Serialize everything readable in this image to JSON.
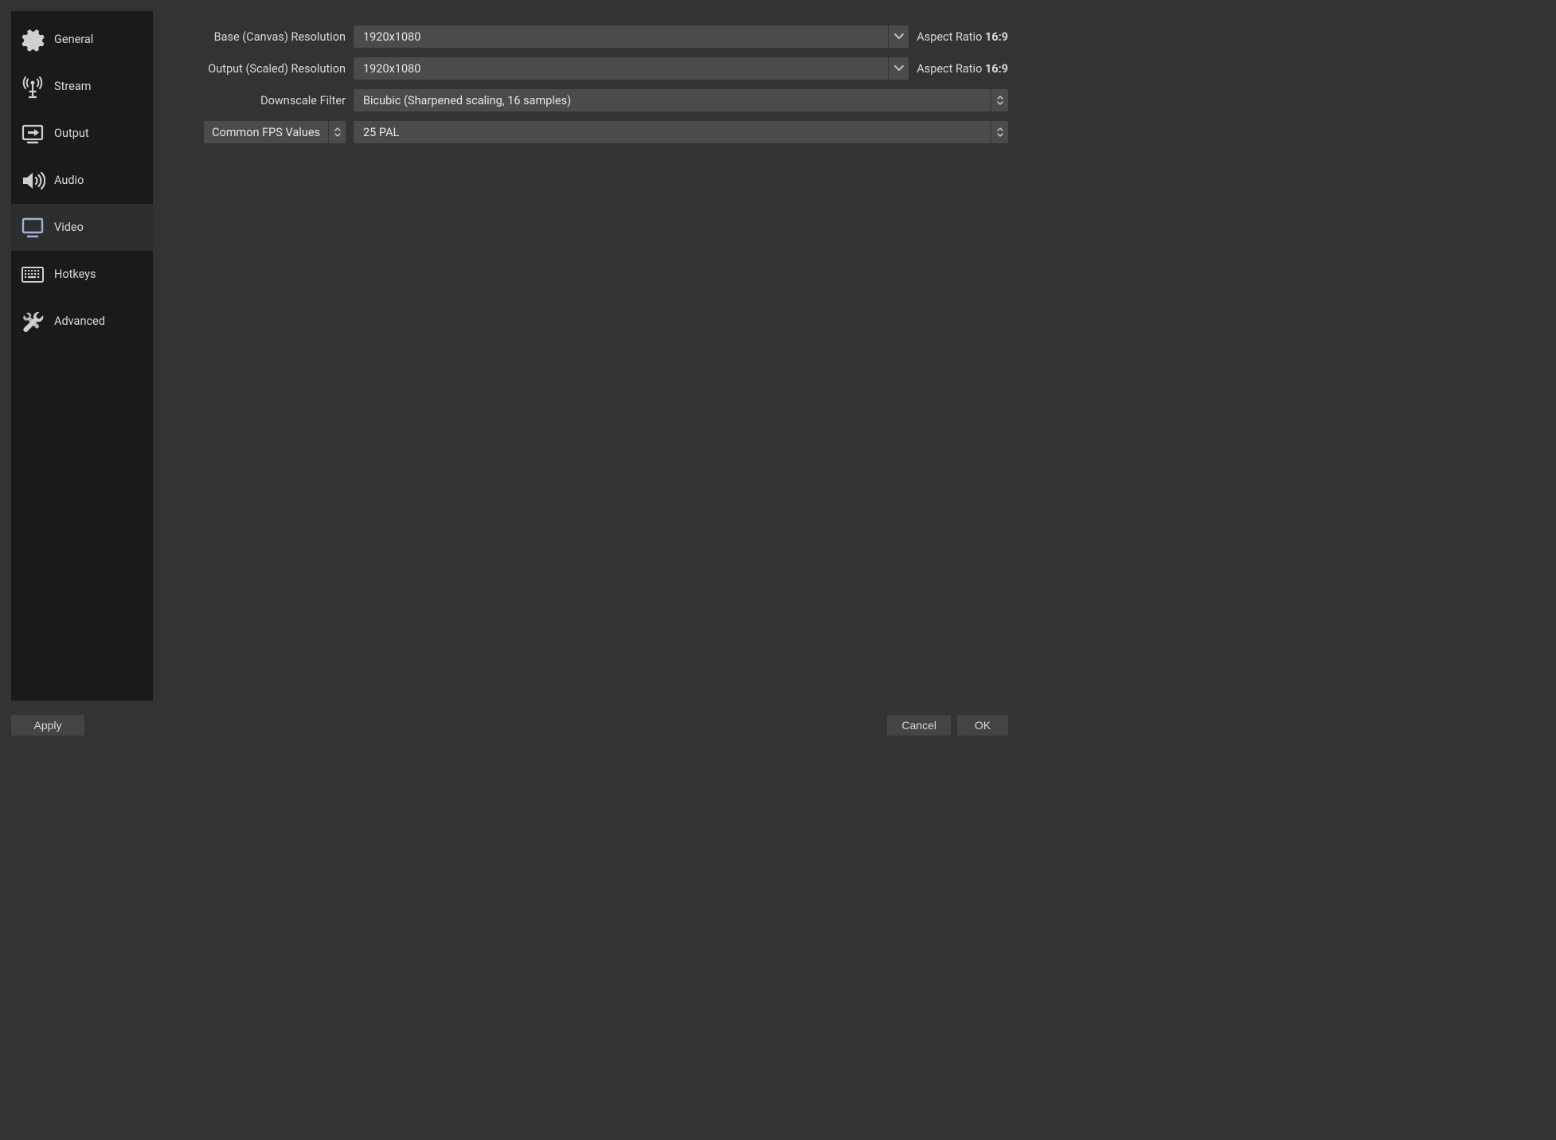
{
  "sidebar": {
    "items": [
      {
        "label": "General",
        "selected": false,
        "icon": "gear-icon"
      },
      {
        "label": "Stream",
        "selected": false,
        "icon": "antenna-icon"
      },
      {
        "label": "Output",
        "selected": false,
        "icon": "output-icon"
      },
      {
        "label": "Audio",
        "selected": false,
        "icon": "speaker-icon"
      },
      {
        "label": "Video",
        "selected": true,
        "icon": "monitor-icon"
      },
      {
        "label": "Hotkeys",
        "selected": false,
        "icon": "keyboard-icon"
      },
      {
        "label": "Advanced",
        "selected": false,
        "icon": "tools-icon"
      }
    ]
  },
  "video": {
    "base_resolution": {
      "label": "Base (Canvas) Resolution",
      "value": "1920x1080",
      "aspect_prefix": "Aspect Ratio ",
      "aspect_value": "16:9"
    },
    "output_resolution": {
      "label": "Output (Scaled) Resolution",
      "value": "1920x1080",
      "aspect_prefix": "Aspect Ratio ",
      "aspect_value": "16:9"
    },
    "downscale_filter": {
      "label": "Downscale Filter",
      "value": "Bicubic (Sharpened scaling, 16 samples)"
    },
    "fps": {
      "mode_label": "Common FPS Values",
      "value": "25 PAL"
    }
  },
  "footer": {
    "apply": "Apply",
    "cancel": "Cancel",
    "ok": "OK"
  }
}
